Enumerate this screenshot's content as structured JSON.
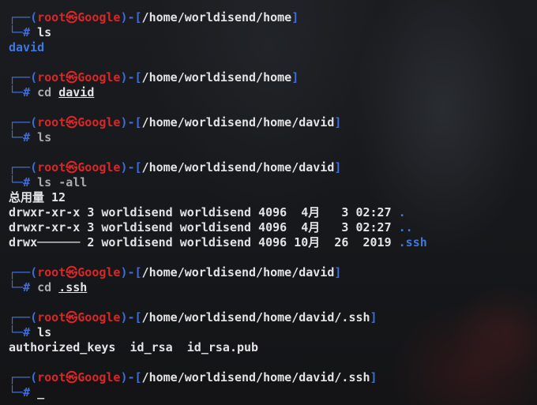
{
  "prompt": {
    "frame_top": "┌──(",
    "frame_bot": "└─",
    "user": "root",
    "skull": "㉿",
    "host": "Google",
    "sep": ")-[",
    "close": "]",
    "hash": "#"
  },
  "blocks": [
    {
      "path": "/home/worldisend/home",
      "cmd": "ls",
      "cmd_dim": false
    },
    {
      "path": "/home/worldisend/home",
      "cmd": "cd ",
      "arg": "david"
    },
    {
      "path": "/home/worldisend/home/david",
      "cmd": "ls",
      "cmd_dim": true
    },
    {
      "path": "/home/worldisend/home/david",
      "cmd": "ls -all",
      "cmd_dim": true
    },
    {
      "path": "/home/worldisend/home/david",
      "cmd": "cd ",
      "arg": ".ssh"
    },
    {
      "path": "/home/worldisend/home/david/.ssh",
      "cmd": "ls",
      "cmd_dim": false
    },
    {
      "path": "/home/worldisend/home/david/.ssh",
      "cmd": "",
      "cursor": "_"
    }
  ],
  "output": {
    "ls_home": "david",
    "total": "总用量 12",
    "listing": [
      {
        "text": "drwxr-xr-x 3 worldisend worldisend 4096  4月   3 02:27 ",
        "name": "."
      },
      {
        "text": "drwxr-xr-x 3 worldisend worldisend 4096  4月   3 02:27 ",
        "name": ".."
      },
      {
        "text": "drwx────── 2 worldisend worldisend 4096 10月  26  2019 ",
        "name": ".ssh"
      }
    ],
    "ssh_files": "authorized_keys  id_rsa  id_rsa.pub"
  },
  "colors": {
    "frame_blue": "#3f6cd6",
    "user_red": "#d92626",
    "dir_blue": "#3f78de",
    "text": "#e3e3e6",
    "background": "#15171a"
  }
}
